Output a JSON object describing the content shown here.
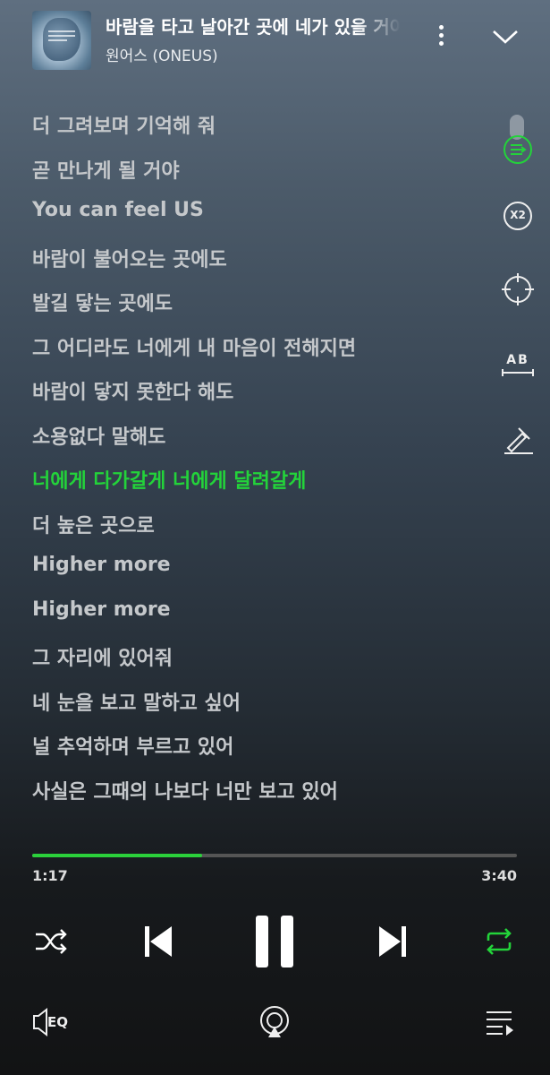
{
  "track": {
    "title": "바람을 타고 날아간 곳에 네가 있을 거야",
    "artist": "원어스 (ONEUS)"
  },
  "lyrics": [
    "더 그려보며 기억해 줘",
    "곧 만나게 될 거야",
    "You can feel US",
    "바람이 불어오는 곳에도",
    "발길 닿는 곳에도",
    "그 어디라도 너에게 내 마음이 전해지면",
    "바람이 닿지 못한다 해도",
    "소용없다 말해도",
    "너에게 다가갈게 너에게 달려갈게",
    "더 높은 곳으로",
    "Higher more",
    "Higher more",
    "그 자리에 있어줘",
    "네 눈을 보고 말하고 싶어",
    "널 추억하며 부르고 있어",
    "사실은 그때의 나보다 너만 보고 있어"
  ],
  "active_line": 8,
  "speed_label": "X2",
  "translation_label": "AB",
  "playback": {
    "current_time": "1:17",
    "total_time": "3:40",
    "progress": 0.35
  },
  "eq_label": "EQ",
  "colors": {
    "accent": "#23d33a",
    "text_dim": "#c5c8cb"
  },
  "icons": [
    "more-vert-icon",
    "chevron-down-icon",
    "lyrics-scroll-icon",
    "speed-icon",
    "target-icon",
    "translate-icon",
    "pen-icon",
    "shuffle-icon",
    "previous-icon",
    "pause-icon",
    "next-icon",
    "repeat-icon",
    "equalizer-icon",
    "cast-icon",
    "playlist-icon"
  ]
}
